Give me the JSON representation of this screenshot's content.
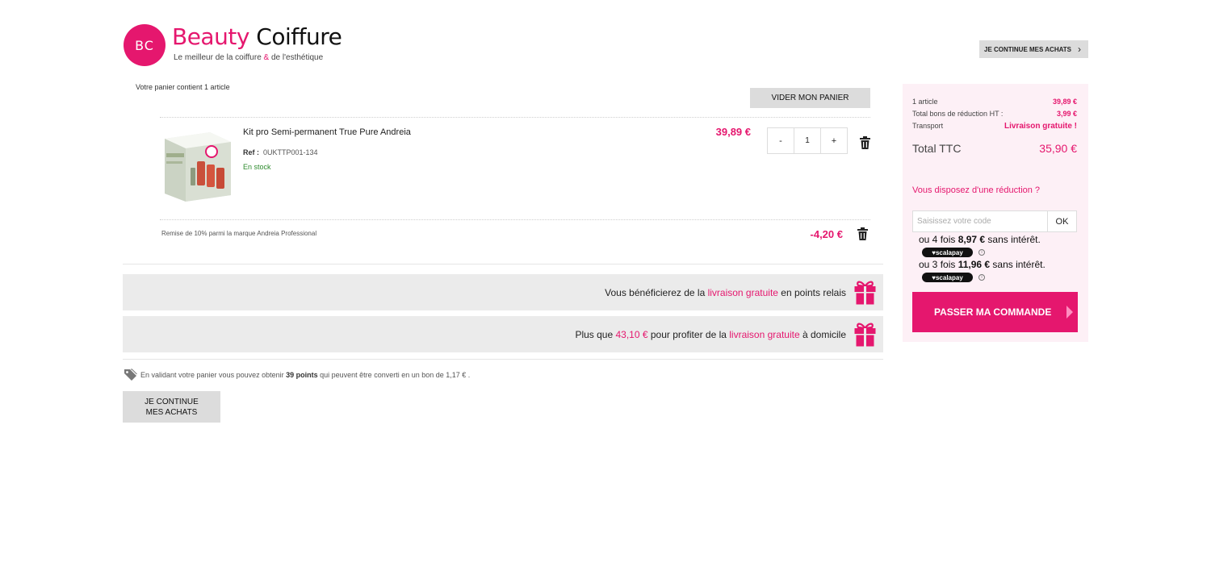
{
  "header": {
    "logo_initials": "BC",
    "brand_part1": "Beauty",
    "brand_part2": "Coiffure",
    "tagline_before": "Le meilleur de la coiffure ",
    "tagline_amp": "&",
    "tagline_after": " de l'esthétique",
    "continue_label": "JE CONTINUE MES ACHATS"
  },
  "cart": {
    "count_text": "Votre panier contient 1 article",
    "clear_label": "VIDER MON PANIER",
    "item": {
      "name": "Kit pro Semi-permanent True Pure Andreia",
      "ref_label": "Ref :",
      "ref_value": "0UKTTP001-134",
      "stock": "En stock",
      "price": "39,89 €",
      "qty_minus": "-",
      "qty_value": "1",
      "qty_plus": "+"
    },
    "discount": {
      "label": "Remise de 10% parmi la marque Andreia Professional",
      "value": "-4,20 €"
    }
  },
  "banners": [
    {
      "before": "Vous bénéficierez de la ",
      "pink1": "livraison gratuite",
      "after": " en points relais"
    },
    {
      "before": "Plus que ",
      "pink1": "43,10 €",
      "middle": " pour profiter de la ",
      "pink2": "livraison gratuite",
      "after": " à domicile"
    }
  ],
  "points": {
    "before": "En validant votre panier vous pouvez obtenir ",
    "bold": "39 points",
    "after": " qui peuvent être converti en un bon de 1,17 € ."
  },
  "bottom_continue": {
    "line1": "JE CONTINUE",
    "line2": "MES ACHATS"
  },
  "summary": {
    "rows": [
      {
        "label": "1 article",
        "value": "39,89 €"
      },
      {
        "label": "Total bons de réduction HT :",
        "value": "3,99 €"
      },
      {
        "label": "Transport",
        "value": "Livraison gratuite !"
      }
    ],
    "total_label": "Total TTC",
    "total_value": "35,90 €",
    "promo_question": "Vous disposez d'une réduction ?",
    "promo_placeholder": "Saisissez votre code",
    "promo_ok": "OK",
    "installments": [
      {
        "prefix": "ou 4 fois ",
        "amount": "8,97 €",
        "suffix": " sans intérêt.",
        "badge": "♥scalapay"
      },
      {
        "prefix": "ou 3 fois ",
        "amount": "11,96 €",
        "suffix": " sans intérêt.",
        "badge": "♥scalapay"
      }
    ],
    "checkout_label": "PASSER MA COMMANDE"
  },
  "colors": {
    "brand_pink": "#e5176e",
    "button_grey": "#dcdcdc",
    "summary_bg": "#fdf0f6",
    "stock_green": "#2e8b2e"
  },
  "icons": [
    "chevron-right-icon",
    "trash-icon",
    "gift-icon",
    "tag-icon",
    "info-icon",
    "arrow-right-icon"
  ]
}
